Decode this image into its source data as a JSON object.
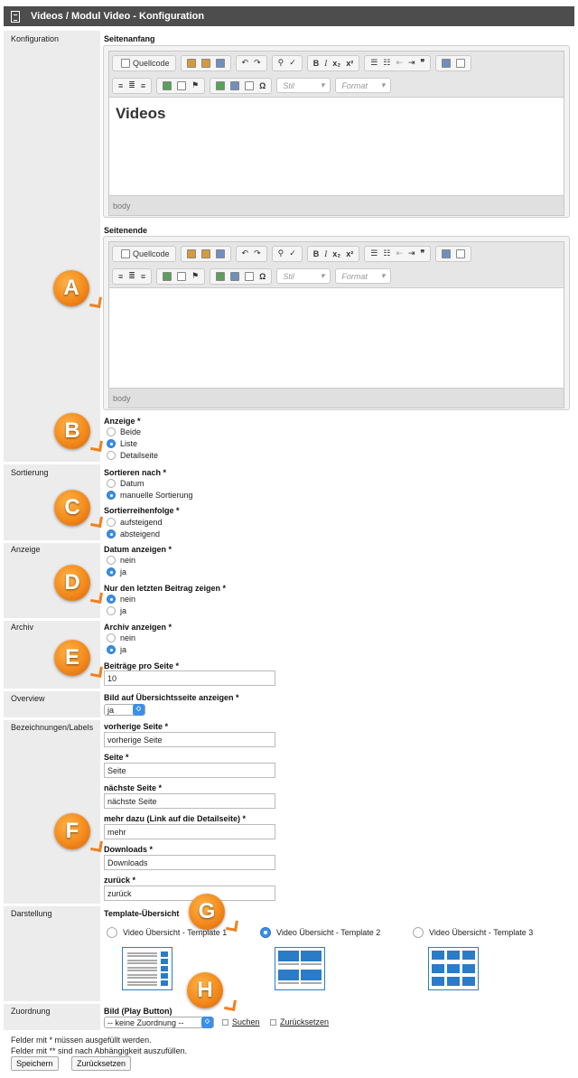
{
  "window": {
    "title": "Videos / Modul Video - Konfiguration"
  },
  "sections": {
    "konfiguration": "Konfiguration",
    "sortierung": "Sortierung",
    "anzeige": "Anzeige",
    "archiv": "Archiv",
    "overview": "Overview",
    "labels": "Bezeichnungen/Labels",
    "darstellung": "Darstellung",
    "zuordnung": "Zuordnung"
  },
  "editor_top": {
    "label": "Seitenanfang",
    "content": "Videos",
    "footer": "body"
  },
  "editor_bottom": {
    "label": "Seitenende",
    "content": "",
    "footer": "body"
  },
  "toolbar": {
    "source": "Quellcode",
    "bold": "B",
    "italic": "I",
    "sub": "x₂",
    "sup": "x²",
    "quote": "❞",
    "omega": "Ω",
    "style_placeholder": "Stil",
    "format_placeholder": "Format"
  },
  "anzeige_field": {
    "label": "Anzeige *",
    "options": [
      "Beide",
      "Liste",
      "Detailseite"
    ],
    "selected": "Liste"
  },
  "sortieren": {
    "label": "Sortieren nach *",
    "options": [
      "Datum",
      "manuelle Sortierung"
    ],
    "selected": "manuelle Sortierung"
  },
  "reihenfolge": {
    "label": "Sortierreihenfolge *",
    "options": [
      "aufsteigend",
      "absteigend"
    ],
    "selected": "absteigend"
  },
  "datum_anzeigen": {
    "label": "Datum anzeigen *",
    "options": [
      "nein",
      "ja"
    ],
    "selected": "ja"
  },
  "letzter_beitrag": {
    "label": "Nur den letzten Beitrag zeigen *",
    "options": [
      "nein",
      "ja"
    ],
    "selected": "nein"
  },
  "archiv_anzeigen": {
    "label": "Archiv anzeigen *",
    "options": [
      "nein",
      "ja"
    ],
    "selected": "ja"
  },
  "beitraege": {
    "label": "Beiträge pro Seite *",
    "value": "10"
  },
  "overview_bild": {
    "label": "Bild auf Übersichtsseite anzeigen *",
    "value": "ja"
  },
  "labels": {
    "prev": {
      "label": "vorherige Seite *",
      "value": "vorherige Seite"
    },
    "page": {
      "label": "Seite *",
      "value": "Seite"
    },
    "next": {
      "label": "nächste Seite *",
      "value": "nächste Seite"
    },
    "more": {
      "label": "mehr dazu (Link auf die Detailseite) *",
      "value": "mehr"
    },
    "downloads": {
      "label": "Downloads *",
      "value": "Downloads"
    },
    "back": {
      "label": "zurück *",
      "value": "zurück"
    }
  },
  "template": {
    "label": "Template-Übersicht",
    "options": [
      "Video Übersicht - Template 1",
      "Video Übersicht - Template 2",
      "Video Übersicht - Template 3"
    ],
    "selected": "Video Übersicht - Template 2"
  },
  "zuordnung_field": {
    "label": "Bild (Play Button)",
    "select_value": "-- keine Zuordnung --",
    "search_link": "Suchen",
    "reset_link": "Zurücksetzen"
  },
  "notes": {
    "required": "Felder mit * müssen ausgefüllt werden.",
    "dependent": "Felder mit ** sind nach Abhängigkeit auszufüllen."
  },
  "buttons": {
    "save": "Speichern",
    "reset": "Zurücksetzen"
  },
  "markers": [
    "A",
    "B",
    "C",
    "D",
    "E",
    "F",
    "G",
    "H"
  ],
  "colors": {
    "title_bar": "#4d4d4d",
    "label_column": "#ececec",
    "accent": "#3b8fe8",
    "marker": "#f28a1c"
  }
}
